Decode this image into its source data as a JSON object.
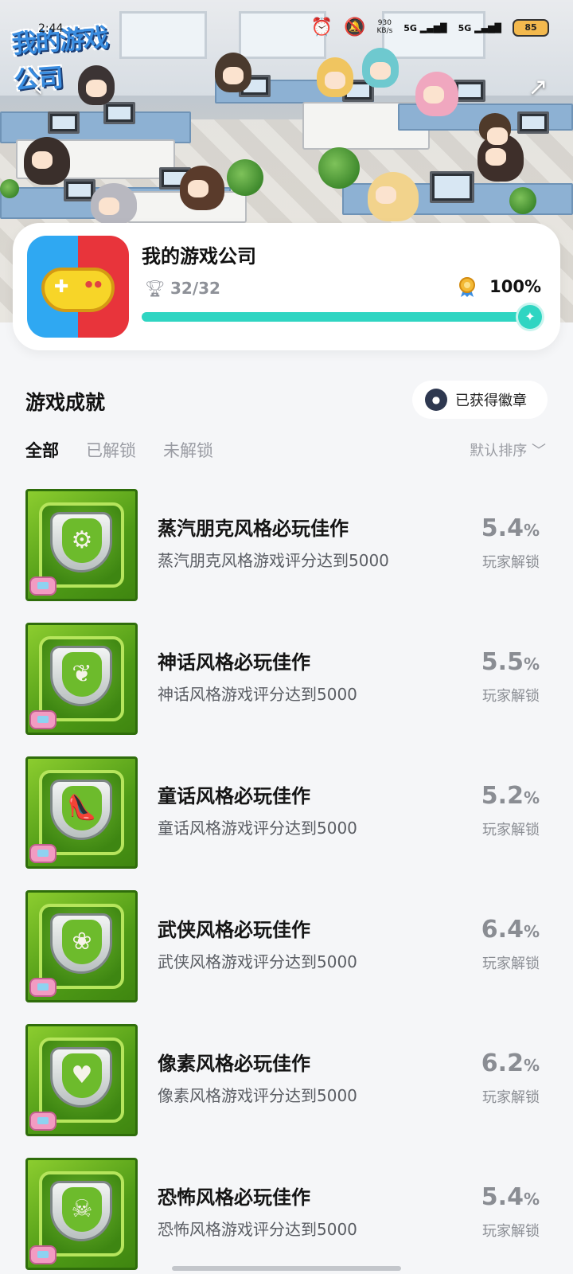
{
  "status_bar": {
    "time": "2:44",
    "net_speed_value": "930",
    "net_speed_unit": "KB/s",
    "signal1": "5G",
    "signal2": "5G",
    "battery": "85"
  },
  "header": {
    "logo_text": "我的游戏公司"
  },
  "game": {
    "title": "我的游戏公司",
    "trophies": "32/32",
    "completion": "100%",
    "progress": 1.0
  },
  "section": {
    "title": "游戏成就",
    "badge_button": "已获得徽章"
  },
  "tabs": [
    {
      "label": "全部",
      "active": true
    },
    {
      "label": "已解锁",
      "active": false
    },
    {
      "label": "未解锁",
      "active": false
    }
  ],
  "sort_label": "默认排序",
  "achievements": [
    {
      "title": "蒸汽朋克风格必玩佳作",
      "desc": "蒸汽朋克风格游戏评分达到5000",
      "rate": "5.4",
      "unit": "%",
      "note": "玩家解锁",
      "icon": "gear-icon",
      "glyph": "⚙"
    },
    {
      "title": "神话风格必玩佳作",
      "desc": "神话风格游戏评分达到5000",
      "rate": "5.5",
      "unit": "%",
      "note": "玩家解锁",
      "icon": "phoenix-icon",
      "glyph": "❦"
    },
    {
      "title": "童话风格必玩佳作",
      "desc": "童话风格游戏评分达到5000",
      "rate": "5.2",
      "unit": "%",
      "note": "玩家解锁",
      "icon": "glass-slipper-icon",
      "glyph": "👠"
    },
    {
      "title": "武侠风格必玩佳作",
      "desc": "武侠风格游戏评分达到5000",
      "rate": "6.4",
      "unit": "%",
      "note": "玩家解锁",
      "icon": "gourd-icon",
      "glyph": "❀"
    },
    {
      "title": "像素风格必玩佳作",
      "desc": "像素风格游戏评分达到5000",
      "rate": "6.2",
      "unit": "%",
      "note": "玩家解锁",
      "icon": "pixel-heart-icon",
      "glyph": "♥"
    },
    {
      "title": "恐怖风格必玩佳作",
      "desc": "恐怖风格游戏评分达到5000",
      "rate": "5.4",
      "unit": "%",
      "note": "玩家解锁",
      "icon": "skull-icon",
      "glyph": "☠"
    }
  ]
}
